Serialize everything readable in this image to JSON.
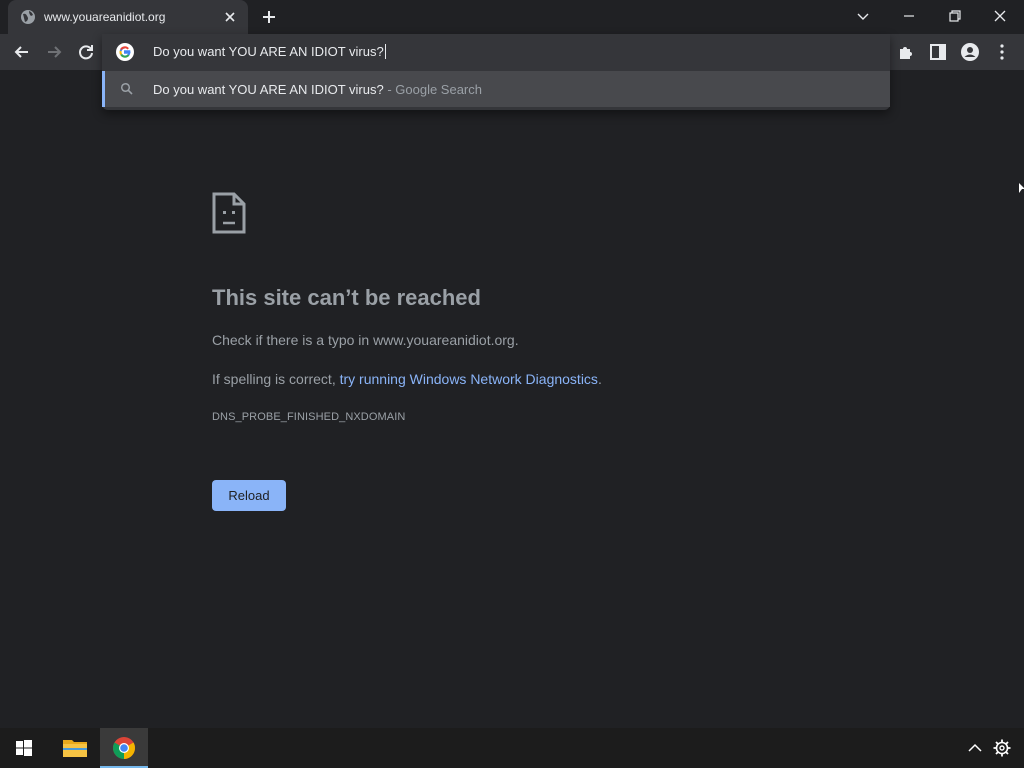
{
  "browser": {
    "tab": {
      "title": "www.youareanidiot.org",
      "favicon": "globe-icon"
    },
    "omnibox": {
      "value": "Do you want YOU ARE AN IDIOT virus?",
      "suggestion_main": "Do you want YOU ARE AN IDIOT virus?",
      "suggestion_suffix": " - Google Search"
    }
  },
  "error_page": {
    "title": "This site can’t be reached",
    "line1": "Check if there is a typo in www.youareanidiot.org.",
    "line2_prefix": "If spelling is correct, ",
    "line2_link": "try running Windows Network Diagnostics",
    "line2_suffix": ".",
    "code": "DNS_PROBE_FINISHED_NXDOMAIN",
    "reload_label": "Reload"
  },
  "colors": {
    "background": "#202124",
    "accent": "#8ab4f8",
    "toolbar": "#35363a",
    "muted_text": "#9aa0a6"
  },
  "taskbar": {
    "items": [
      "windows-start-icon",
      "file-explorer-icon",
      "chrome-icon"
    ],
    "active": "chrome-icon",
    "tray": [
      "chevron-up-icon",
      "gear-icon"
    ]
  }
}
